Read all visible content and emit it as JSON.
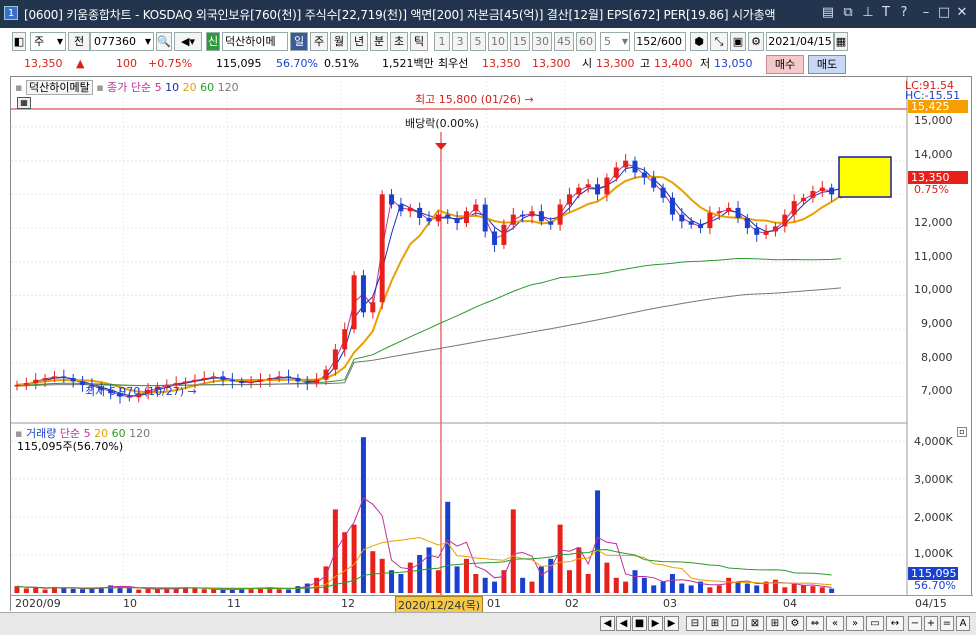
{
  "window": {
    "number": "1",
    "title": "[0600] 키움종합차트 - KOSDAQ 외국인보유[760(천)] 주식수[22,719(천)] 액면[200] 자본금[45(억)] 결산[12월] EPS[672] PER[19.86] 시가총액"
  },
  "toolbar": {
    "period_type": "주",
    "prev_label": "전",
    "stock_code": "077360",
    "indicator_tag": "신",
    "stock_name": "덕산하이메",
    "periods": [
      "일",
      "주",
      "월",
      "년",
      "분",
      "초",
      "틱"
    ],
    "numbers": [
      "1",
      "3",
      "5",
      "10",
      "15",
      "30",
      "45",
      "60"
    ],
    "interval_value": "5",
    "count_display": "152/600",
    "date_value": "2021/04/15"
  },
  "quote": {
    "price": "13,350",
    "change_arrow": "▲",
    "change": "100",
    "change_pct": "+0.75%",
    "volume": "115,095",
    "vol_ratio": "56.70%",
    "turnover": "0.51%",
    "amount": "1,521백만",
    "best_label": "최우선",
    "best_ask": "13,350",
    "best_bid": "13,300",
    "open_label": "시",
    "open": "13,300",
    "high_label": "고",
    "high": "13,400",
    "low_label": "저",
    "low": "13,050",
    "buy_label": "매수",
    "sell_label": "매도"
  },
  "price_panel": {
    "name_tag": "덕산하이메탈",
    "ma_legend_prefix": "종가 단순",
    "ma_periods": [
      "5",
      "10",
      "20",
      "60",
      "120"
    ],
    "ma_colors": [
      "#c0309a",
      "#1a2fb0",
      "#e8a000",
      "#2a9a2a",
      "#777777"
    ],
    "high_note": "최고 15,800 (01/26)",
    "low_note": "최저 6,970 (10/27)",
    "dividend_note": "배당락(0.00%)",
    "lc_label": "LC:91.54",
    "hc_label": "HC:-15.51",
    "price_tag": "15,425",
    "current_tag": "13,350",
    "current_pct_tag": "0.75%",
    "y_labels": [
      "15,000",
      "14,000",
      "13,000",
      "12,000",
      "11,000",
      "10,000",
      "9,000",
      "8,000",
      "7,000"
    ]
  },
  "volume_panel": {
    "legend_prefix": "거래량",
    "legend_ma": "단순",
    "ma_periods": [
      "5",
      "20",
      "60",
      "120"
    ],
    "current_text": "115,095주(56.70%)",
    "y_labels": [
      "4,000K",
      "3,000K",
      "2,000K",
      "1,000K"
    ],
    "current_tag": "115,095",
    "current_pct_tag": "56.70%"
  },
  "date_axis": {
    "labels": [
      "2020/09",
      "10",
      "11",
      "12",
      "2020/12/24(목)",
      "01",
      "02",
      "03",
      "04",
      "04/15"
    ]
  },
  "chart_data": {
    "type": "candlestick",
    "title": "덕산하이메탈",
    "x_range": [
      "2020/09",
      "2021/04/15"
    ],
    "ylim": [
      6500,
      15600
    ],
    "highest": {
      "value": 15800,
      "date": "01/26"
    },
    "lowest": {
      "value": 6970,
      "date": "10/27"
    },
    "close_series": [
      7350,
      7400,
      7500,
      7550,
      7600,
      7550,
      7450,
      7350,
      7300,
      7200,
      7100,
      7000,
      6980,
      7100,
      7200,
      7300,
      7350,
      7400,
      7450,
      7500,
      7550,
      7600,
      7500,
      7450,
      7400,
      7450,
      7500,
      7550,
      7600,
      7550,
      7450,
      7400,
      7500,
      7800,
      8400,
      9000,
      10600,
      9500,
      9800,
      13000,
      12700,
      12500,
      12600,
      12300,
      12200,
      12400,
      12300,
      12150,
      12500,
      12700,
      11900,
      11500,
      12100,
      12400,
      12350,
      12500,
      12200,
      12100,
      12700,
      13000,
      13200,
      13300,
      13000,
      13500,
      13800,
      14000,
      13650,
      13500,
      13200,
      12900,
      12400,
      12200,
      12100,
      12000,
      12450,
      12500,
      12600,
      12300,
      12000,
      11800,
      11900,
      12050,
      12400,
      12800,
      12900,
      13100,
      13200,
      13000,
      13350
    ],
    "volume_k": [
      180,
      120,
      150,
      90,
      160,
      140,
      110,
      100,
      130,
      150,
      200,
      170,
      140,
      90,
      120,
      100,
      110,
      130,
      150,
      120,
      100,
      90,
      80,
      100,
      120,
      130,
      140,
      150,
      100,
      90,
      180,
      250,
      400,
      700,
      2200,
      1600,
      1800,
      4100,
      1100,
      900,
      600,
      500,
      800,
      1000,
      1200,
      600,
      2400,
      700,
      900,
      500,
      400,
      300,
      600,
      2200,
      400,
      300,
      700,
      900,
      1800,
      600,
      1200,
      500,
      2700,
      800,
      400,
      300,
      600,
      400,
      200,
      300,
      500,
      250,
      200,
      300,
      150,
      200,
      400,
      300,
      250,
      200,
      300,
      350,
      150,
      250,
      200,
      180,
      150,
      115
    ]
  }
}
